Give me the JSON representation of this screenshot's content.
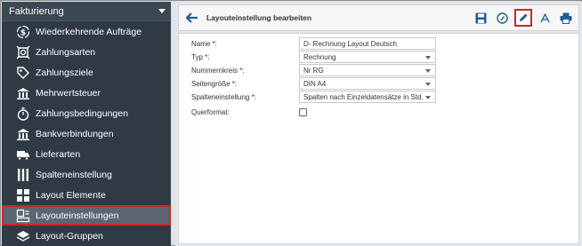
{
  "sidebar": {
    "header": "Fakturierung",
    "items": [
      {
        "label": "Wiederkehrende Aufträge",
        "icon": "dollar-cycle-icon"
      },
      {
        "label": "Zahlungsarten",
        "icon": "money-icon"
      },
      {
        "label": "Zahlungsziele",
        "icon": "tag-icon"
      },
      {
        "label": "Mehrwertsteuer",
        "icon": "bank-icon"
      },
      {
        "label": "Zahlungsbedingungen",
        "icon": "stopwatch-icon"
      },
      {
        "label": "Bankverbindungen",
        "icon": "bank-icon"
      },
      {
        "label": "Lieferarten",
        "icon": "truck-icon"
      },
      {
        "label": "Spalteneinstellung",
        "icon": "columns-icon"
      },
      {
        "label": "Layout Elemente",
        "icon": "grid-icon"
      },
      {
        "label": "Layouteinstellungen",
        "icon": "layout-icon"
      },
      {
        "label": "Layout-Gruppen",
        "icon": "layers-icon"
      }
    ]
  },
  "toolbar": {
    "title": "Layouteinstellung bearbeiten"
  },
  "form": {
    "name_label": "Name *:",
    "name_value": "D- Rechnung Layout Deutsch",
    "typ_label": "Typ *:",
    "typ_value": "Rechnung",
    "nummernkreis_label": "Nummernkreis *:",
    "nummernkreis_value": "Nr RG",
    "seitengroesse_label": "Seitengröße *:",
    "seitengroesse_value": "DIN A4",
    "spalteneinstellung_label": "Spalteneinstellung *:",
    "spalteneinstellung_value": "Spalten nach Einzeldatensätze in Std.",
    "querformat_label": "Querformat:"
  },
  "colors": {
    "sidebar_bg": "#2f3a45",
    "active_outline": "#c62828",
    "accent_blue": "#1f5c99"
  }
}
